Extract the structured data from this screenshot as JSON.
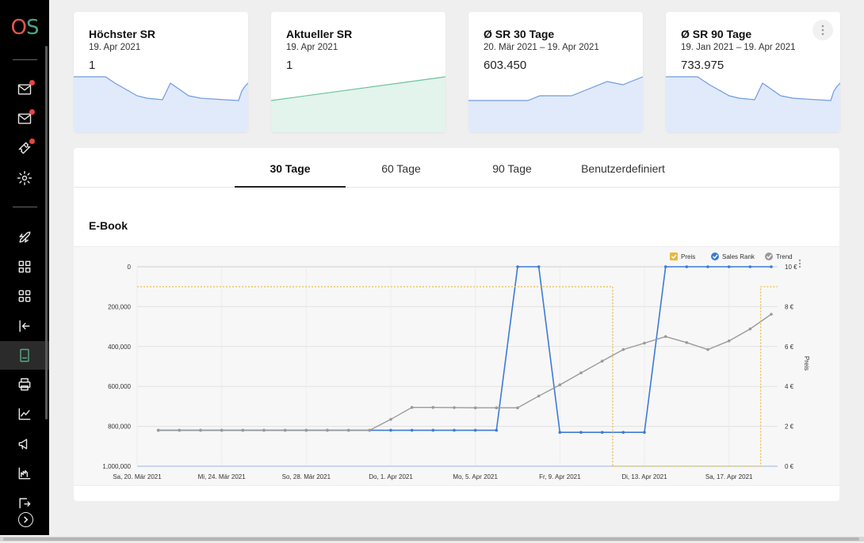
{
  "logo": {
    "o": "O",
    "s": "S"
  },
  "sidebar": {
    "items": [
      {
        "icon": "mail-icon",
        "badge": true
      },
      {
        "icon": "mail-check-icon",
        "badge": true
      },
      {
        "icon": "ticket-icon",
        "badge": true
      },
      {
        "icon": "gear-icon",
        "badge": false
      },
      {
        "icon": "rocket-icon",
        "badge": false
      },
      {
        "icon": "grid-icon",
        "badge": false
      },
      {
        "icon": "grid-alt-icon",
        "badge": false
      },
      {
        "icon": "sign-in-icon",
        "badge": false
      },
      {
        "icon": "book-icon",
        "badge": false,
        "active": true
      },
      {
        "icon": "printer-icon",
        "badge": false
      },
      {
        "icon": "line-chart-icon",
        "badge": false
      },
      {
        "icon": "megaphone-icon",
        "badge": false
      },
      {
        "icon": "factory-chart-icon",
        "badge": false
      },
      {
        "icon": "export-icon",
        "badge": false
      }
    ],
    "expand_icon": "chevron-right-icon"
  },
  "cards": [
    {
      "title": "Höchster SR",
      "subtitle": "19. Apr 2021",
      "value": "1",
      "color": "#6f9be0",
      "fill": "#e1eafb"
    },
    {
      "title": "Aktueller SR",
      "subtitle": "19. Apr 2021",
      "value": "1",
      "color": "#6dc49a",
      "fill": "#e2f4ec"
    },
    {
      "title": "Ø SR 30 Tage",
      "subtitle": "20. Mär 2021 – 19. Apr 2021",
      "value": "603.450",
      "color": "#6f9be0",
      "fill": "#e1eafb"
    },
    {
      "title": "Ø SR 90 Tage",
      "subtitle": "19. Jan 2021 – 19. Apr 2021",
      "value": "733.975",
      "color": "#6f9be0",
      "fill": "#e1eafb"
    }
  ],
  "tabs": [
    {
      "label": "30 Tage",
      "active": true
    },
    {
      "label": "60 Tage",
      "active": false
    },
    {
      "label": "90 Tage",
      "active": false
    },
    {
      "label": "Benutzerdefiniert",
      "active": false
    }
  ],
  "section_title": "E-Book",
  "chart_data": {
    "type": "line",
    "x_tick_labels": [
      "Sa, 20. Mär 2021",
      "Mi, 24. Mär 2021",
      "So, 28. Mär 2021",
      "Do, 1. Apr 2021",
      "Mo, 5. Apr 2021",
      "Fr, 9. Apr 2021",
      "Di, 13. Apr 2021",
      "Sa, 17. Apr 2021"
    ],
    "x_start": "2021-03-20",
    "y_left": {
      "ticks": [
        "0",
        "200,000",
        "400,000",
        "600,000",
        "800,000",
        "1,000,000"
      ],
      "range": [
        0,
        1000000
      ],
      "reversed": true
    },
    "y_right": {
      "ticks": [
        "0 €",
        "2 €",
        "4 €",
        "6 €",
        "8 €",
        "10 €"
      ],
      "range": [
        0,
        10
      ],
      "label": "Preis"
    },
    "legend": [
      {
        "name": "Preis",
        "color": "#e8b840"
      },
      {
        "name": "Sales Rank",
        "color": "#3b7bd8"
      },
      {
        "name": "Trend",
        "color": "#9a9a9a"
      }
    ],
    "series": [
      {
        "name": "Sales Rank",
        "color": "#3b7bd8",
        "points": [
          [
            1,
            820000
          ],
          [
            2,
            820000
          ],
          [
            3,
            820000
          ],
          [
            4,
            820000
          ],
          [
            5,
            820000
          ],
          [
            6,
            820000
          ],
          [
            7,
            820000
          ],
          [
            8,
            820000
          ],
          [
            9,
            820000
          ],
          [
            10,
            820000
          ],
          [
            11,
            820000
          ],
          [
            12,
            820000
          ],
          [
            13,
            820000
          ],
          [
            14,
            820000
          ],
          [
            15,
            820000
          ],
          [
            16,
            820000
          ],
          [
            17,
            820000
          ],
          [
            18,
            1
          ],
          [
            19,
            1
          ],
          [
            20,
            830000
          ],
          [
            21,
            830000
          ],
          [
            22,
            830000
          ],
          [
            23,
            830000
          ],
          [
            24,
            830000
          ],
          [
            25,
            1
          ],
          [
            26,
            1
          ],
          [
            27,
            1
          ],
          [
            28,
            1
          ],
          [
            29,
            1
          ],
          [
            30,
            1
          ]
        ]
      },
      {
        "name": "Trend",
        "color": "#9a9a9a",
        "points": [
          [
            1,
            820000
          ],
          [
            2,
            820000
          ],
          [
            3,
            820000
          ],
          [
            4,
            820000
          ],
          [
            5,
            820000
          ],
          [
            6,
            820000
          ],
          [
            7,
            820000
          ],
          [
            8,
            820000
          ],
          [
            9,
            820000
          ],
          [
            10,
            820000
          ],
          [
            11,
            820000
          ],
          [
            12,
            765000
          ],
          [
            13,
            705000
          ],
          [
            14,
            705000
          ],
          [
            15,
            706000
          ],
          [
            16,
            707000
          ],
          [
            17,
            707000
          ],
          [
            18,
            707000
          ],
          [
            19,
            648000
          ],
          [
            20,
            592000
          ],
          [
            21,
            532000
          ],
          [
            22,
            473000
          ],
          [
            23,
            415000
          ],
          [
            24,
            383000
          ],
          [
            25,
            350000
          ],
          [
            26,
            380000
          ],
          [
            27,
            415000
          ],
          [
            28,
            372000
          ],
          [
            29,
            312000
          ],
          [
            30,
            238000
          ]
        ]
      },
      {
        "name": "Preis",
        "color": "#e8b840",
        "axis": "right",
        "points": [
          [
            0,
            9
          ],
          [
            22.5,
            9
          ],
          [
            22.5,
            0
          ],
          [
            29.5,
            0
          ],
          [
            29.5,
            9
          ],
          [
            30.3,
            9
          ]
        ]
      }
    ],
    "x_range": [
      0,
      30.3
    ],
    "grid": true,
    "legend_position": "top-right"
  }
}
